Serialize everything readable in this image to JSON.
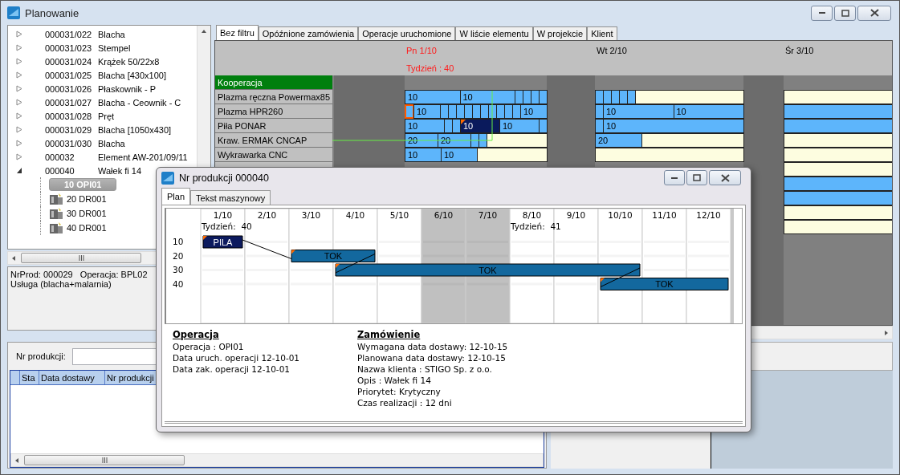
{
  "window": {
    "title": "Planowanie"
  },
  "tree": {
    "items": [
      {
        "code": "000031/022",
        "name": "Blacha",
        "expanded": false
      },
      {
        "code": "000031/023",
        "name": "Stempel",
        "expanded": false
      },
      {
        "code": "000031/024",
        "name": "Krążek 50/22x8",
        "expanded": false
      },
      {
        "code": "000031/025",
        "name": "Blacha [430x100]",
        "expanded": false
      },
      {
        "code": "000031/026",
        "name": "Płaskownik - P",
        "expanded": false
      },
      {
        "code": "000031/027",
        "name": "Blacha - Ceownik - C",
        "expanded": false
      },
      {
        "code": "000031/028",
        "name": "Pręt",
        "expanded": false
      },
      {
        "code": "000031/029",
        "name": "Blacha [1050x430]",
        "expanded": false
      },
      {
        "code": "000031/030",
        "name": "Blacha",
        "expanded": false
      },
      {
        "code": "000032",
        "name": "Element AW-201/09/11",
        "expanded": false
      },
      {
        "code": "000040",
        "name": "Wałek fi 14",
        "expanded": true,
        "children": [
          {
            "label": "10 OPI01",
            "selected": true
          },
          {
            "label": "20 DR001",
            "selected": false
          },
          {
            "label": "30 DR001",
            "selected": false
          },
          {
            "label": "40 DR001",
            "selected": false
          }
        ]
      }
    ]
  },
  "details": [
    "NrProd: 000029   Operacja: BPL02",
    "Usługa (blacha+malarnia)"
  ],
  "search": {
    "label": "Nr produkcji:"
  },
  "orders_table": {
    "columns": [
      "Sta",
      "Data dostawy",
      "Nr produkcji"
    ]
  },
  "gantt": {
    "tabs": [
      {
        "label": "Bez filtru",
        "selected": true
      },
      {
        "label": "Opóźnione zamówienia",
        "selected": false
      },
      {
        "label": "Operacje uruchomione",
        "selected": false
      },
      {
        "label": "W liście elementu",
        "selected": false
      },
      {
        "label": "W projekcie",
        "selected": false
      },
      {
        "label": "Klient",
        "selected": false
      }
    ],
    "days": [
      {
        "label": "Pn 1/10",
        "week": "Tydzień : 40",
        "highlighted": true
      },
      {
        "label": "Wt 2/10",
        "highlighted": false
      },
      {
        "label": "Śr 3/10",
        "highlighted": false
      }
    ],
    "resources": [
      {
        "name": "Kooperacja",
        "kind": "group"
      },
      {
        "name": "Plazma ręczna Powermax85",
        "kind": "machine",
        "day_1": [
          {
            "kind": "busy",
            "label": "10"
          },
          {
            "kind": "busy",
            "label": "10"
          },
          {
            "kind": "busy"
          },
          {
            "kind": "busy"
          },
          {
            "kind": "busy"
          },
          {
            "kind": "busy"
          }
        ],
        "day_2": [
          {
            "kind": "busy"
          },
          {
            "kind": "busy"
          },
          {
            "kind": "busy"
          },
          {
            "kind": "busy"
          },
          {
            "kind": "busy"
          },
          {
            "kind": "free"
          }
        ],
        "day_3": [
          {
            "kind": "free"
          }
        ]
      },
      {
        "name": "Plazma HPR260",
        "kind": "machine",
        "day_1": [
          {
            "kind": "flagged"
          },
          {
            "kind": "busy",
            "label": "10"
          },
          {
            "kind": "busy"
          },
          {
            "kind": "busy"
          },
          {
            "kind": "busy"
          },
          {
            "kind": "busy"
          },
          {
            "kind": "busy"
          },
          {
            "kind": "busy"
          },
          {
            "kind": "busy"
          },
          {
            "kind": "busy"
          },
          {
            "kind": "busy"
          },
          {
            "kind": "busy"
          },
          {
            "kind": "busy",
            "label": "10"
          }
        ],
        "day_2": [
          {
            "kind": "busy"
          },
          {
            "kind": "busy",
            "label": "10"
          },
          {
            "kind": "busy",
            "label": "10"
          }
        ],
        "day_3": [
          {
            "kind": "busy"
          }
        ]
      },
      {
        "name": "Piła PONAR",
        "kind": "machine",
        "day_1": [
          {
            "kind": "busy",
            "label": "10"
          },
          {
            "kind": "busy"
          },
          {
            "kind": "busy"
          },
          {
            "kind": "selected",
            "label": "10"
          },
          {
            "kind": "busy",
            "label": "10"
          },
          {
            "kind": "busy"
          }
        ],
        "day_2": [
          {
            "kind": "busy"
          },
          {
            "kind": "busy",
            "label": "10"
          }
        ],
        "day_3": [
          {
            "kind": "busy"
          }
        ]
      },
      {
        "name": "Kraw. ERMAK CNCAP",
        "kind": "machine",
        "day_1": [
          {
            "kind": "busy",
            "label": "20"
          },
          {
            "kind": "busy",
            "label": "20"
          },
          {
            "kind": "busy"
          },
          {
            "kind": "busy"
          },
          {
            "kind": "free"
          }
        ],
        "day_2": [
          {
            "kind": "busy",
            "label": "20"
          },
          {
            "kind": "free"
          }
        ],
        "day_3": [
          {
            "kind": "free"
          }
        ]
      },
      {
        "name": "Wykrawarka CNC",
        "kind": "machine",
        "day_1": [
          {
            "kind": "busy",
            "label": "10"
          },
          {
            "kind": "busy",
            "label": "10"
          },
          {
            "kind": "free"
          }
        ],
        "day_2": [
          {
            "kind": "free"
          }
        ],
        "day_3": [
          {
            "kind": "free"
          }
        ]
      },
      {
        "kind": "machine",
        "day_3": [
          {
            "kind": "free"
          }
        ]
      },
      {
        "kind": "machine",
        "day_3": [
          {
            "kind": "busy"
          }
        ]
      },
      {
        "kind": "machine",
        "day_3": [
          {
            "kind": "busy"
          }
        ]
      },
      {
        "kind": "machine",
        "day_3": [
          {
            "kind": "free"
          }
        ]
      },
      {
        "kind": "machine",
        "day_3": [
          {
            "kind": "free"
          }
        ]
      }
    ]
  },
  "dialog": {
    "title": "Nr produkcji 000040",
    "tabs": [
      {
        "label": "Plan",
        "selected": true
      },
      {
        "label": "Tekst maszynowy",
        "selected": false
      }
    ],
    "plan": {
      "days": [
        {
          "label": "1/10",
          "weekend": false,
          "week": "Tydzień:  40"
        },
        {
          "label": "2/10",
          "weekend": false
        },
        {
          "label": "3/10",
          "weekend": false
        },
        {
          "label": "4/10",
          "weekend": false
        },
        {
          "label": "5/10",
          "weekend": false
        },
        {
          "label": "6/10",
          "weekend": true
        },
        {
          "label": "7/10",
          "weekend": true
        },
        {
          "label": "8/10",
          "weekend": false,
          "week": "Tydzień:  41"
        },
        {
          "label": "9/10",
          "weekend": false
        },
        {
          "label": "10/10",
          "weekend": false
        },
        {
          "label": "11/10",
          "weekend": false
        },
        {
          "label": "12/10",
          "weekend": false
        }
      ],
      "operations": [
        {
          "label": "10",
          "bar": "PILA",
          "kind": "saw",
          "active": [
            true,
            false,
            false,
            false,
            false,
            false,
            false,
            false,
            false,
            false,
            false,
            false
          ]
        },
        {
          "label": "20",
          "bar": "TOK",
          "kind": "lathe",
          "active": [
            false,
            false,
            true,
            true,
            false,
            false,
            false,
            false,
            false,
            false,
            false,
            false
          ]
        },
        {
          "label": "30",
          "bar": "TOK",
          "kind": "lathe",
          "active": [
            false,
            false,
            false,
            true,
            true,
            true,
            true,
            true,
            true,
            true,
            false,
            false
          ]
        },
        {
          "label": "40",
          "bar": "TOK",
          "kind": "lathe",
          "active": [
            false,
            false,
            false,
            false,
            false,
            false,
            false,
            false,
            false,
            true,
            true,
            true
          ]
        }
      ]
    },
    "operation_info": {
      "title": "Operacja",
      "lines": [
        "Operacja : OPI01",
        "Data uruch. operacji 12-10-01",
        "Data zak. operacji 12-10-01"
      ]
    },
    "order_info": {
      "title": "Zamówienie",
      "lines": [
        "Wymagana data dostawy: 12-10-15",
        "Planowana data dostawy: 12-10-15",
        "Nazwa klienta : STIGO Sp. z o.o.",
        "Opis : Wałek fi 14",
        "Priorytet: Krytyczny",
        "Czas realizacji : 12 dni"
      ]
    }
  }
}
